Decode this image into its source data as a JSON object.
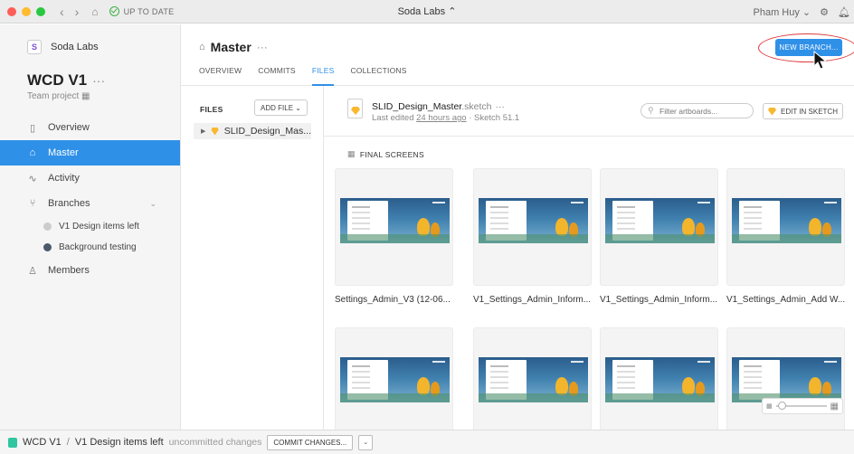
{
  "titlebar": {
    "status": "UP TO DATE",
    "org_switcher": "Soda Labs ⌃",
    "user": "Pham Huy ⌄"
  },
  "sidebar": {
    "org_name": "Soda Labs",
    "project_title": "WCD V1",
    "project_menu": "···",
    "project_type": "Team project",
    "items": [
      {
        "label": "Overview",
        "icon": "document-icon"
      },
      {
        "label": "Master",
        "icon": "branch-home-icon",
        "active": true
      },
      {
        "label": "Activity",
        "icon": "activity-icon"
      },
      {
        "label": "Branches",
        "icon": "branches-icon"
      },
      {
        "label": "Members",
        "icon": "person-icon"
      }
    ],
    "branches": [
      "V1 Design items left",
      "Background testing"
    ]
  },
  "header": {
    "title": "Master",
    "menu": "···",
    "tabs": [
      "OVERVIEW",
      "COMMITS",
      "FILES",
      "COLLECTIONS"
    ],
    "active_tab": "FILES",
    "new_branch_label": "NEW BRANCH..."
  },
  "files": {
    "label": "FILES",
    "add_file_label": "ADD FILE ⌄",
    "file_name": "SLID_Design_Mas..."
  },
  "document": {
    "name": "SLID_Design_Master",
    "ext": ".sketch",
    "menu": "···",
    "meta_prefix": "Last edited ",
    "meta_link": "24 hours ago",
    "meta_suffix": " · Sketch 51.1",
    "filter_placeholder": "Filter artboards...",
    "edit_label": "EDIT IN SKETCH",
    "section": "FINAL SCREENS",
    "artboards": [
      "Settings_Admin_V3 (12-06...",
      "V1_Settings_Admin_Inform...",
      "V1_Settings_Admin_Inform...",
      "V1_Settings_Admin_Add W..."
    ]
  },
  "statusbar": {
    "project": "WCD V1",
    "separator": "/",
    "branch": "V1 Design items left",
    "uncommitted": "uncommitted changes",
    "commit_label": "COMMIT CHANGES...",
    "dropdown": "⌄"
  },
  "colors": {
    "accent": "#2f90e8",
    "annotation": "#e0393b"
  }
}
